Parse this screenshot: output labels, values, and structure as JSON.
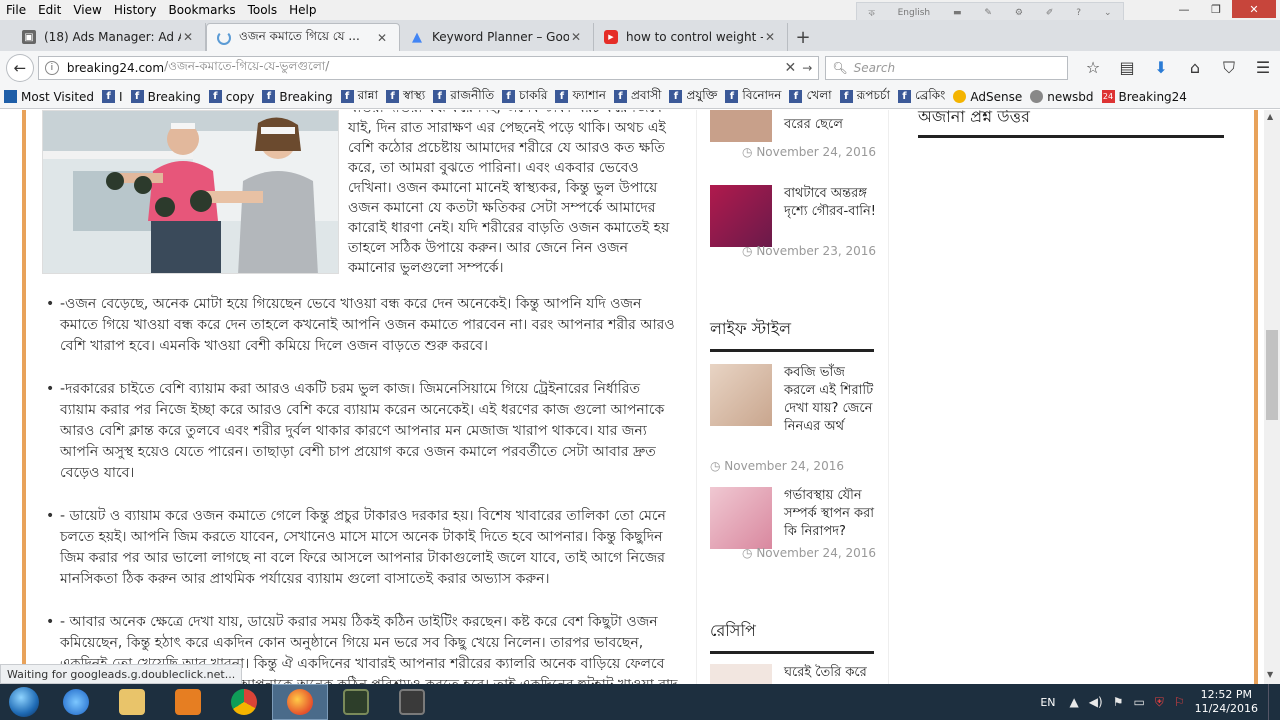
{
  "menu": [
    "File",
    "Edit",
    "View",
    "History",
    "Bookmarks",
    "Tools",
    "Help"
  ],
  "lang_widget": "English",
  "tabs": [
    {
      "label": "(18) Ads Manager: Ad Acc...",
      "icon": "ads-manager-icon"
    },
    {
      "label": "ওজন কমাতে গিয়ে যে ...",
      "icon": "loading-spinner-icon",
      "active": true
    },
    {
      "label": "Keyword Planner – Google ...",
      "icon": "google-ads-icon"
    },
    {
      "label": "how to control weight - Yo...",
      "icon": "youtube-icon"
    }
  ],
  "url": {
    "host": "breaking24.com",
    "path": "/ওজন-কমাতে-গিয়ে-যে-ভুলগুলো/"
  },
  "search_placeholder": "Search",
  "bookmarks": [
    {
      "label": "Most Visited",
      "icon": "most-visited-icon"
    },
    {
      "label": "I",
      "icon": "facebook-icon"
    },
    {
      "label": "Breaking",
      "icon": "facebook-icon"
    },
    {
      "label": "copy",
      "icon": "facebook-icon"
    },
    {
      "label": "Breaking",
      "icon": "facebook-icon"
    },
    {
      "label": "রান্না",
      "icon": "facebook-icon"
    },
    {
      "label": "স্বাস্থ্য",
      "icon": "facebook-icon"
    },
    {
      "label": "রাজনীতি",
      "icon": "facebook-icon"
    },
    {
      "label": "চাকরি",
      "icon": "facebook-icon"
    },
    {
      "label": "ফ্যাশান",
      "icon": "facebook-icon"
    },
    {
      "label": "প্রবাসী",
      "icon": "facebook-icon"
    },
    {
      "label": "প্রযুক্তি",
      "icon": "facebook-icon"
    },
    {
      "label": "বিনোদন",
      "icon": "facebook-icon"
    },
    {
      "label": "খেলা",
      "icon": "facebook-icon"
    },
    {
      "label": "রূপচর্চা",
      "icon": "facebook-icon"
    },
    {
      "label": "ব্রেকিং",
      "icon": "facebook-icon"
    },
    {
      "label": "AdSense",
      "icon": "adsense-icon"
    },
    {
      "label": "newsbd",
      "icon": "globe-icon"
    },
    {
      "label": "Breaking24",
      "icon": "breaking24-icon"
    }
  ],
  "article": {
    "intro": "খাওয়া দাওয়া বন্ধ করে দিই, অনেক টাকা খরচ করে জিমে যাই, দিন রাত সারাক্ষণ এর পেছনেই পড়ে থাকি। অথচ এই বেশি কঠোর প্রচেষ্টায় আমাদের শরীরে যে আরও কত ক্ষতি করে, তা আমরা বুঝতে পারিনা। এবং একবার ভেবেও দেখিনা। ওজন কমানো মানেই স্বাস্থ্যকর, কিন্তু ভুল উপায়ে ওজন কমানো যে কতটা ক্ষতিকর সেটা সম্পর্কে আমাদের কারোই ধারণা নেই। যদি শরীরের বাড়তি ওজন কমাতেই হয় তাহলে সঠিক উপায়ে করুন। আর জেনে নিন ওজন কমানোর ভুলগুলো সম্পর্কে।",
    "bullets": [
      "-ওজন বেড়েছে, অনেক মোটা হয়ে গিয়েছেন ভেবে খাওয়া বন্ধ করে দেন অনেকেই। কিন্তু আপনি যদি ওজন কমাতে গিয়ে খাওয়া বন্ধ করে দেন তাহলে কখনোই আপনি ওজন কমাতে পারবেন না। বরং আপনার শরীর আরও বেশি খারাপ হবে। এমনকি খাওয়া বেশী কমিয়ে দিলে ওজন বাড়তে শুরু করবে।",
      "-দরকারের চাইতে বেশি ব্যায়াম করা আরও একটি চরম ভুল কাজ। জিমনেসিয়ামে গিয়ে ট্রেইনারের নির্ধারিত ব্যায়াম করার পর নিজে ইচ্ছা করে আরও বেশি করে ব্যায়াম করেন অনেকেই। এই ধরণের কাজ গুলো আপনাকে আরও বেশি ক্লান্ত করে তুলবে এবং শরীর দুর্বল থাকার কারণে আপনার মন মেজাজ খারাপ থাকবে। যার জন্য আপনি অসুস্থ হয়েও যেতে পারেন। তাছাড়া বেশী চাপ প্রয়োগ করে ওজন কমালে পরবর্তীতে সেটা আবার দ্রুত বেড়েও যাবে।",
      "- ডায়েট ও ব্যায়াম করে ওজন কমাতে গেলে কিন্তু প্রচুর টাকারও দরকার হয়। বিশেষ খাবারের তালিকা তো মেনে চলতে হয়ই। আপনি জিম করতে যাবেন, সেখানেও মাসে মাসে অনেক টাকাই দিতে হবে আপনার। কিন্তু কিছুদিন জিম করার পর আর ভালো লাগছে না বলে ফিরে আসলে আপনার টাকাগুলোই জলে যাবে, তাই আগে নিজের মানসিকতা ঠিক করুন আর প্রাথমিক পর্যায়ের ব্যায়াম গুলো বাসাতেই করার অভ্যাস করুন।",
      "- আবার অনেক ক্ষেত্রে দেখা যায়, ডায়েট করার সময় ঠিকই কঠিন ডাইটিং করছেন। কষ্ট করে বেশ কিছুটা ওজন কমিয়েছেন, কিন্তু হঠাৎ করে একদিন কোন অনুষ্ঠানে গিয়ে মন ভরে সব কিছু খেয়ে নিলেন। তারপর ভাবছেন, একদিনই তো খেয়েছি আর খাবনা। কিন্তু ঐ একদিনের খাবারই আপনার শরীরের ক্যালরি অনেক বাড়িয়ে ফেলবে এবং তা আবার বার্ন করতে হলে আপনাকে অনেক কঠিন পরিশ্রমও করতে হবে। তাই একদিনের হুটহাট খাওয়া বাদ দিতে"
    ]
  },
  "sidebar": {
    "top_posts": [
      {
        "title": "বরের ছেলে",
        "date": "November 24, 2016"
      },
      {
        "title": "বাথটাবে অন্তরঙ্গ দৃশ্যে গৌরব-বানি!",
        "date": "November 23, 2016"
      }
    ],
    "lifestyle_heading": "লাইফ স্টাইল",
    "lifestyle_posts": [
      {
        "title": "কবজি ভাঁজ করলে এই শিরাটি দেখা যায়? জেনে নিনএর অর্থ",
        "date": "November 24, 2016"
      },
      {
        "title": "গর্ভাবস্থায় যৌন সম্পর্ক স্থাপন করা কি নিরাপদ?",
        "date": "November 24, 2016"
      }
    ],
    "recipe_heading": "রেসিপি",
    "recipe_posts": [
      {
        "title": "ঘরেই তৈরি করে"
      }
    ]
  },
  "right_col_heading": "অজানা প্রশ্ন উত্তর",
  "status": "Waiting for googleads.g.doubleclick.net...",
  "taskbar": {
    "lang": "EN",
    "time": "12:52 PM",
    "date": "11/24/2016"
  }
}
